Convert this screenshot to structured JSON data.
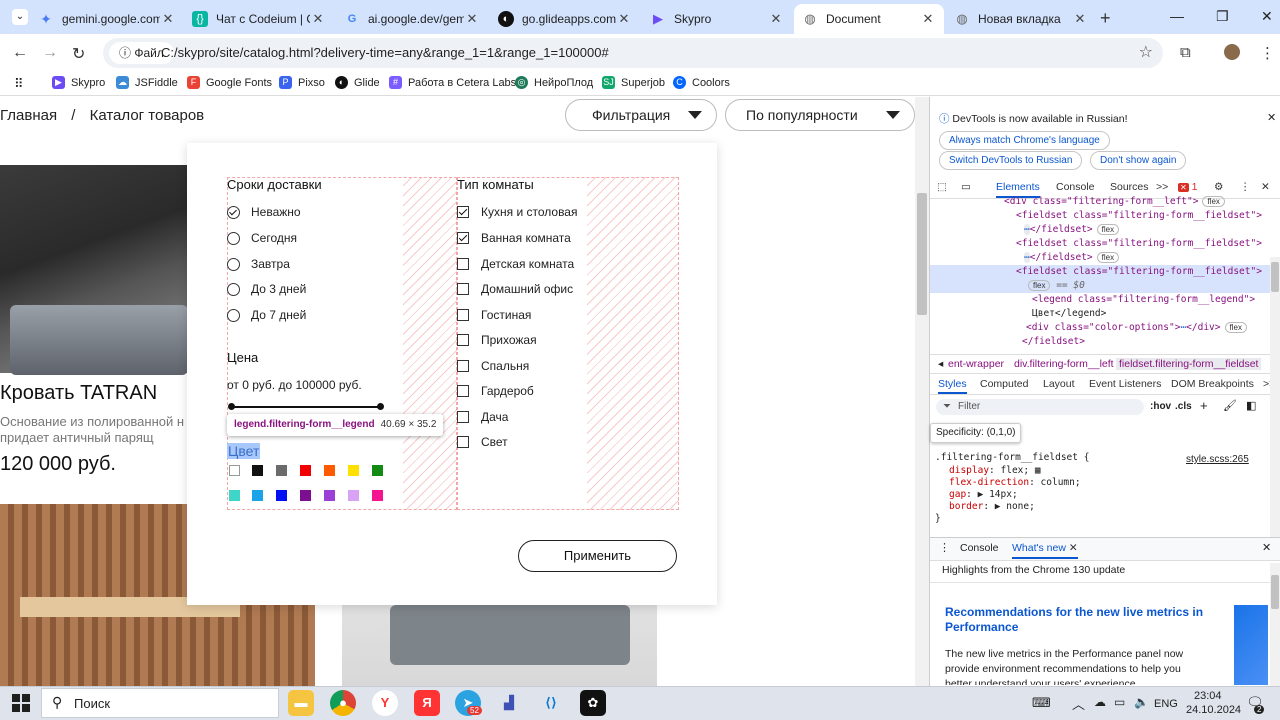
{
  "browser": {
    "tabs": [
      {
        "label": "gemini.google.com",
        "icon": "sparkle-icon",
        "color": "#4b7bf5"
      },
      {
        "label": "Чат с Codeium | Cod",
        "icon": "codeium-icon",
        "color": "#09b6a2"
      },
      {
        "label": "ai.google.dev/gemin",
        "icon": "google-icon",
        "color": "#4285f4"
      },
      {
        "label": "go.glideapps.com/ap",
        "icon": "glide-icon",
        "color": "#111111"
      },
      {
        "label": "Skypro",
        "icon": "skypro-icon",
        "color": "#6c4cf5"
      },
      {
        "label": "Document",
        "icon": "globe-icon",
        "color": "#666666"
      },
      {
        "label": "Новая вкладка",
        "icon": "globe-icon",
        "color": "#666666"
      }
    ],
    "new_tab": "+",
    "address": {
      "chip": "Файл",
      "url": "C:/skypro/site/catalog.html?delivery-time=any&range_1=1&range_1=100000#"
    },
    "bookmarks": [
      {
        "label": "Skypro",
        "color": "#6c4cf5"
      },
      {
        "label": "JSFiddle",
        "color": "#3b8bd6"
      },
      {
        "label": "Google Fonts",
        "color": "#ea4335"
      },
      {
        "label": "Pixso",
        "color": "#3a63f0"
      },
      {
        "label": "Glide",
        "color": "#111111"
      },
      {
        "label": "Работа в Cetera Labs",
        "color": "#7b5cff"
      },
      {
        "label": "НейроПлод",
        "color": "#1f7a5a"
      },
      {
        "label": "Superjob",
        "color": "#12a86b"
      },
      {
        "label": "Coolors",
        "color": "#0066ff"
      }
    ]
  },
  "page": {
    "breadcrumb": {
      "home": "Главная",
      "separator": "/",
      "current": "Каталог товаров"
    },
    "filter_button": "Фильтрация",
    "sort_select": "По популярности",
    "product": {
      "title": "Кровать TATRAN",
      "description_1": "Основание из полированной н",
      "description_2": "придает античный парящ",
      "price": "120 000 руб."
    }
  },
  "filter_modal": {
    "delivery": {
      "legend": "Сроки доставки",
      "options": [
        {
          "label": "Неважно",
          "checked": true
        },
        {
          "label": "Сегодня",
          "checked": false
        },
        {
          "label": "Завтра",
          "checked": false
        },
        {
          "label": "До 3 дней",
          "checked": false
        },
        {
          "label": "До 7 дней",
          "checked": false
        }
      ]
    },
    "price": {
      "legend": "Цена",
      "range_text": "от 0 руб. до 100000 руб."
    },
    "color": {
      "legend": "Цвет",
      "swatches": [
        "#ffffff",
        "#111111",
        "#6b6b6b",
        "#f20000",
        "#ff5a00",
        "#ffe100",
        "#138a13",
        "#3fd6c9",
        "#1aa3e8",
        "#0010f5",
        "#7a0f8f",
        "#9b3fd6",
        "#d9a3f5",
        "#f5138f"
      ]
    },
    "room": {
      "legend": "Тип комнаты",
      "options": [
        {
          "label": "Кухня и столовая",
          "checked": true
        },
        {
          "label": "Ванная комната",
          "checked": true
        },
        {
          "label": "Детская комната",
          "checked": false
        },
        {
          "label": "Домашний офис",
          "checked": false
        },
        {
          "label": "Гостиная",
          "checked": false
        },
        {
          "label": "Прихожая",
          "checked": false
        },
        {
          "label": "Спальня",
          "checked": false
        },
        {
          "label": "Гардероб",
          "checked": false
        },
        {
          "label": "Дача",
          "checked": false
        },
        {
          "label": "Свет",
          "checked": false
        }
      ]
    },
    "apply_button": "Применить",
    "inspect_tooltip": {
      "selector": "legend.filtering-form__legend",
      "size": "40.69 × 35.2"
    }
  },
  "devtools": {
    "notice": "DevTools is now available in Russian!",
    "notice_buttons": [
      "Always match Chrome's language",
      "Switch DevTools to Russian",
      "Don't show again"
    ],
    "tabs": [
      "Elements",
      "Console",
      "Sources",
      ">>"
    ],
    "error_count": "1",
    "dom": {
      "l1_tag": "<div class=\"filtering-form__left\">",
      "fieldset_open": "<fieldset class=\"filtering-form__fieldset\">",
      "fieldset_close": "</fieldset>",
      "ellipsis": "⋯",
      "flex": "flex",
      "selected_suffix": "== $0",
      "legend_open": "<legend class=\"filtering-form__legend\">",
      "legend_text": "Цвет</legend>",
      "color_div": "<div class=\"color-options\">",
      "div_close": "</div>"
    },
    "breadcrumbs": [
      "ent-wrapper",
      "div.filtering-form__left",
      "fieldset.filtering-form__fieldset"
    ],
    "styles_tabs": [
      "Styles",
      "Computed",
      "Layout",
      "Event Listeners",
      "DOM Breakpoints",
      ">>"
    ],
    "filter_placeholder": "Filter",
    "hov": ":hov",
    "cls": ".cls",
    "specificity": "Specificity: (0,1,0)",
    "rule": {
      "selector": ".filtering-form__fieldset {",
      "source": "style.scss:265",
      "decls": [
        {
          "prop": "display",
          "value": "flex;"
        },
        {
          "prop": "flex-direction",
          "value": "column;"
        },
        {
          "prop": "gap",
          "value": "▶ 14px;"
        },
        {
          "prop": "border",
          "value": "▶ none;"
        }
      ],
      "close": "}"
    },
    "drawer_tabs": [
      "Console",
      "What's new"
    ],
    "highlights": "Highlights from the Chrome 130 update",
    "news_title": "Recommendations for the new live metrics in Performance",
    "news_body": "The new live metrics in the Performance panel now provide environment recommendations to help you better understand your users' experience."
  },
  "taskbar": {
    "search": "Поиск",
    "lang": "ENG",
    "time": "23:04",
    "date": "24.10.2024",
    "telegram_badge": "52",
    "notif_badge": "2"
  }
}
